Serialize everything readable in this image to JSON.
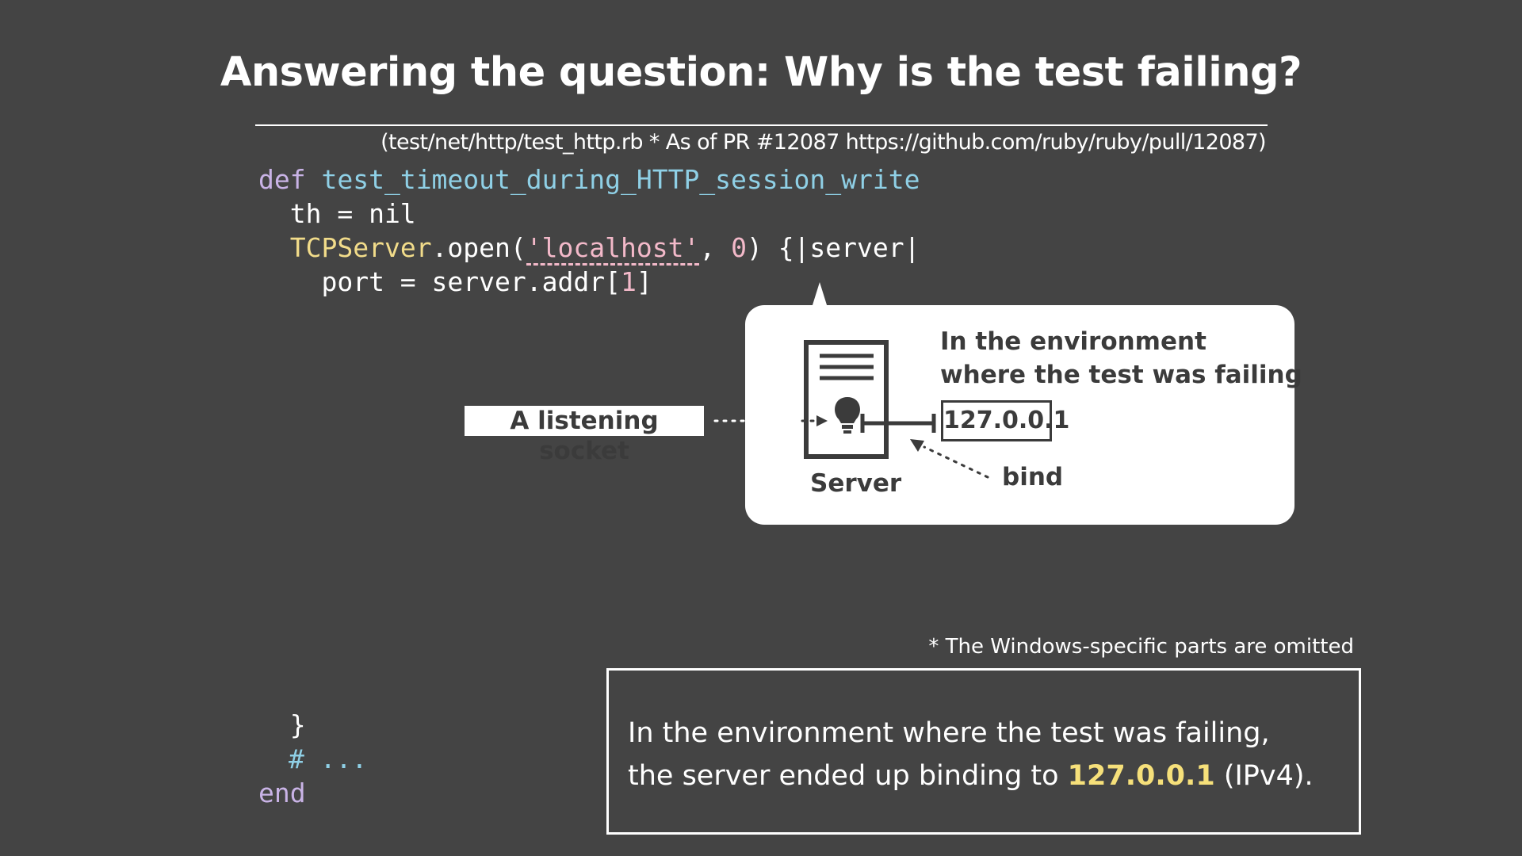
{
  "slide": {
    "title": "Answering the question: Why is the test failing?",
    "source_note": "(test/net/http/test_http.rb * As of PR #12087 https://github.com/ruby/ruby/pull/12087)"
  },
  "code": {
    "line1_kw": "def",
    "line1_fn": "test_timeout_during_HTTP_session_write",
    "line2": "  th = nil",
    "line3_cls": "TCPServer",
    "line3_a": ".open(",
    "line3_str": "'localhost'",
    "line3_b": ", ",
    "line3_num": "0",
    "line3_c": ") {|server|",
    "line4_a": "    port = server.addr[",
    "line4_num": "1",
    "line4_b": "]",
    "close_brace": "  }",
    "comment": "# ...",
    "end_kw": "end"
  },
  "diagram": {
    "env_line1": "In the environment",
    "env_line2": "where the test was failing",
    "ip_address": "127.0.0.1",
    "server_label": "Server",
    "bind_label": "bind",
    "socket_label": "A listening socket",
    "server_icon": "server-document-icon",
    "bulb_icon": "lightbulb-icon"
  },
  "footnote": "* The Windows-specific parts are omitted",
  "summary": {
    "line1": "In the environment where the test was failing,",
    "line2_a": "the server ended up binding to ",
    "line2_hl": "127.0.0.1",
    "line2_b": " (IPv4)."
  },
  "colors": {
    "background": "#444444",
    "keyword": "#c9b3e6",
    "function": "#8fd0e6",
    "class": "#f2dc8a",
    "string": "#f3b9c9",
    "highlight": "#f6e07a"
  }
}
